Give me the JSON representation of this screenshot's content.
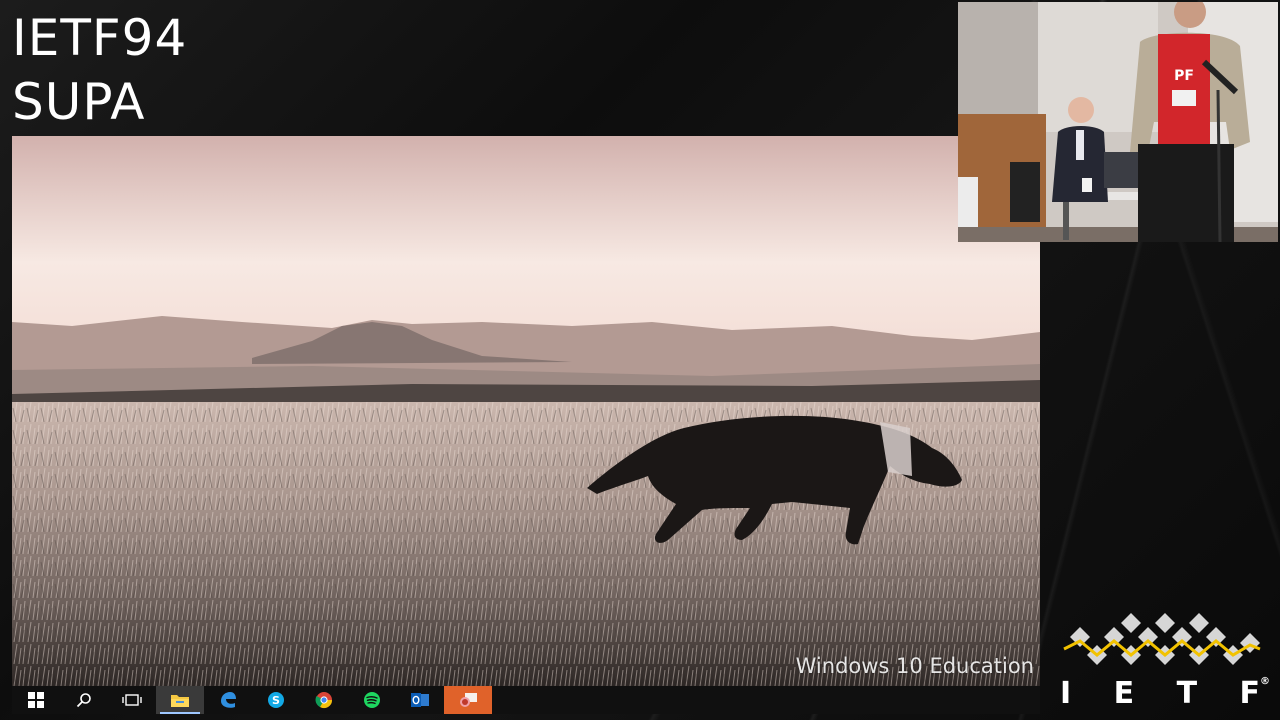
{
  "slide": {
    "event": "IETF94",
    "session": "SUPA"
  },
  "shared_screen": {
    "watermark": "Windows 10 Education",
    "taskbar": {
      "items": [
        {
          "name": "start",
          "icon": "windows-start-icon"
        },
        {
          "name": "search",
          "icon": "search-icon"
        },
        {
          "name": "task-view",
          "icon": "task-view-icon"
        },
        {
          "name": "file-explorer",
          "icon": "folder-icon",
          "active": true
        },
        {
          "name": "edge",
          "icon": "edge-icon"
        },
        {
          "name": "skype",
          "icon": "skype-icon"
        },
        {
          "name": "chrome",
          "icon": "chrome-icon"
        },
        {
          "name": "spotify",
          "icon": "spotify-icon"
        },
        {
          "name": "outlook",
          "icon": "outlook-icon"
        },
        {
          "name": "presentation-app",
          "icon": "slides-icon",
          "highlight": true
        }
      ]
    }
  },
  "speaker_cam": {
    "shirt_text": "PF"
  },
  "logo": {
    "letters": [
      "I",
      "E",
      "T",
      "F"
    ],
    "reg_mark": "®",
    "colors": {
      "diamonds": "#d6d6d6",
      "line": "#f2c200"
    }
  }
}
